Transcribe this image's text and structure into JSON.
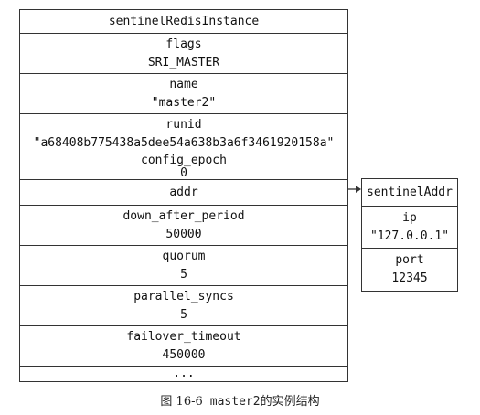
{
  "main_struct": {
    "title": "sentinelRedisInstance",
    "fields": [
      {
        "name": "flags",
        "value": "SRI_MASTER"
      },
      {
        "name": "name",
        "value": "\"master2\""
      },
      {
        "name": "runid",
        "value": "\"a68408b775438a5dee54a638b3a6f3461920158a\""
      },
      {
        "name": "config_epoch",
        "value": "0"
      },
      {
        "name": "addr",
        "value": ""
      },
      {
        "name": "down_after_period",
        "value": "50000"
      },
      {
        "name": "quorum",
        "value": "5"
      },
      {
        "name": "parallel_syncs",
        "value": "5"
      },
      {
        "name": "failover_timeout",
        "value": "450000"
      },
      {
        "name": "...",
        "value": ""
      }
    ]
  },
  "addr_struct": {
    "title": "sentinelAddr",
    "fields": [
      {
        "name": "ip",
        "value": "\"127.0.0.1\""
      },
      {
        "name": "port",
        "value": "12345"
      }
    ]
  },
  "caption": {
    "figure_label": "图 16-6",
    "code": "master2",
    "description": "的实例结构"
  }
}
